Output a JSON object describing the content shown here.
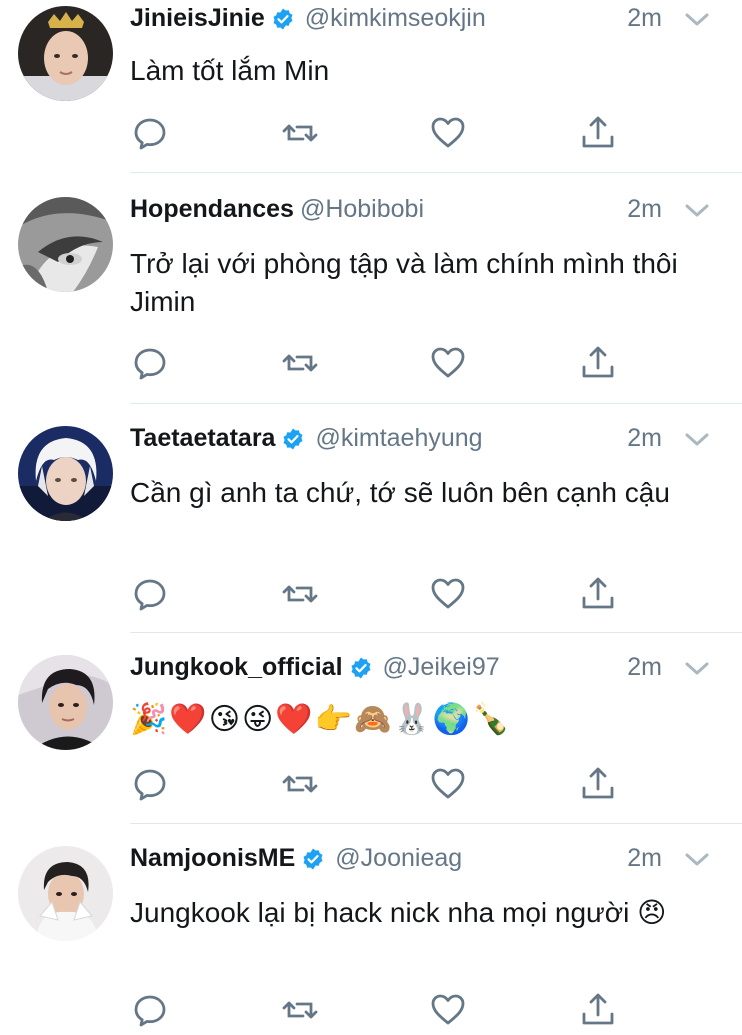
{
  "tweets": [
    {
      "name": "JinieisJinie",
      "verified": true,
      "handle": "@kimkimseokjin",
      "time": "2m",
      "text": "Làm tốt lắm Min"
    },
    {
      "name": "Hopendances",
      "verified": false,
      "handle": "@Hobibobi",
      "time": "2m",
      "text": "Trở lại với phòng tập và làm chính mình thôi Jimin"
    },
    {
      "name": "Taetaetatara",
      "verified": true,
      "handle": "@kimtaehyung",
      "time": "2m",
      "text": "Cần gì anh ta chứ, tớ sẽ luôn bên cạnh cậu"
    },
    {
      "name": "Jungkook_official",
      "verified": true,
      "handle": "@Jeikei97",
      "time": "2m",
      "text": "🎉❤️😘😜❤️👉🙈🐰🌍🍾"
    },
    {
      "name": "NamjoonisME",
      "verified": true,
      "handle": "@Joonieag",
      "time": "2m",
      "text": "Jungkook lại bị hack nick nha mọi người 😠"
    }
  ],
  "icons": {
    "reply": "reply-icon",
    "retweet": "retweet-icon",
    "like": "heart-icon",
    "share": "share-icon",
    "verified": "verified-badge-icon",
    "menu": "chevron-down-icon"
  },
  "colors": {
    "text": "#14171a",
    "secondary": "#657786",
    "verified": "#1da1f2",
    "divider": "#e1e8ed"
  }
}
